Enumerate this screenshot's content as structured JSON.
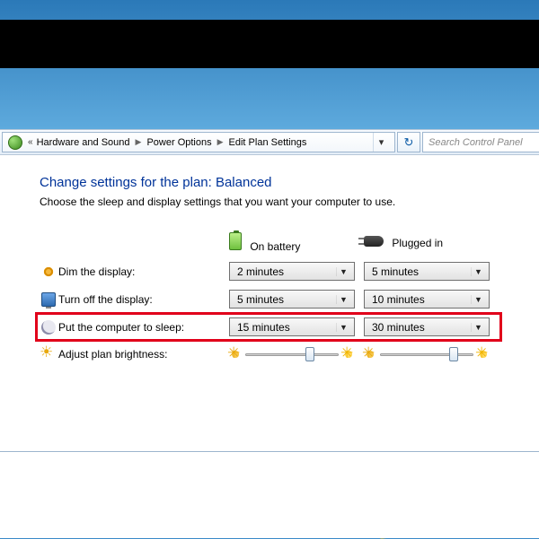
{
  "breadcrumb": {
    "back_indicator": "«",
    "items": [
      "Hardware and Sound",
      "Power Options",
      "Edit Plan Settings"
    ]
  },
  "search": {
    "placeholder": "Search Control Panel"
  },
  "page": {
    "heading": "Change settings for the plan: Balanced",
    "subtext": "Choose the sleep and display settings that you want your computer to use."
  },
  "columns": {
    "battery": "On battery",
    "plugged": "Plugged in"
  },
  "rows": {
    "dim": {
      "label": "Dim the display:",
      "battery": "2 minutes",
      "plugged": "5 minutes"
    },
    "turnoff": {
      "label": "Turn off the display:",
      "battery": "5 minutes",
      "plugged": "10 minutes"
    },
    "sleep": {
      "label": "Put the computer to sleep:",
      "battery": "15 minutes",
      "plugged": "30 minutes"
    },
    "bright": {
      "label": "Adjust plan brightness:"
    }
  },
  "brightness": {
    "battery_percent": 70,
    "plugged_percent": 80
  }
}
